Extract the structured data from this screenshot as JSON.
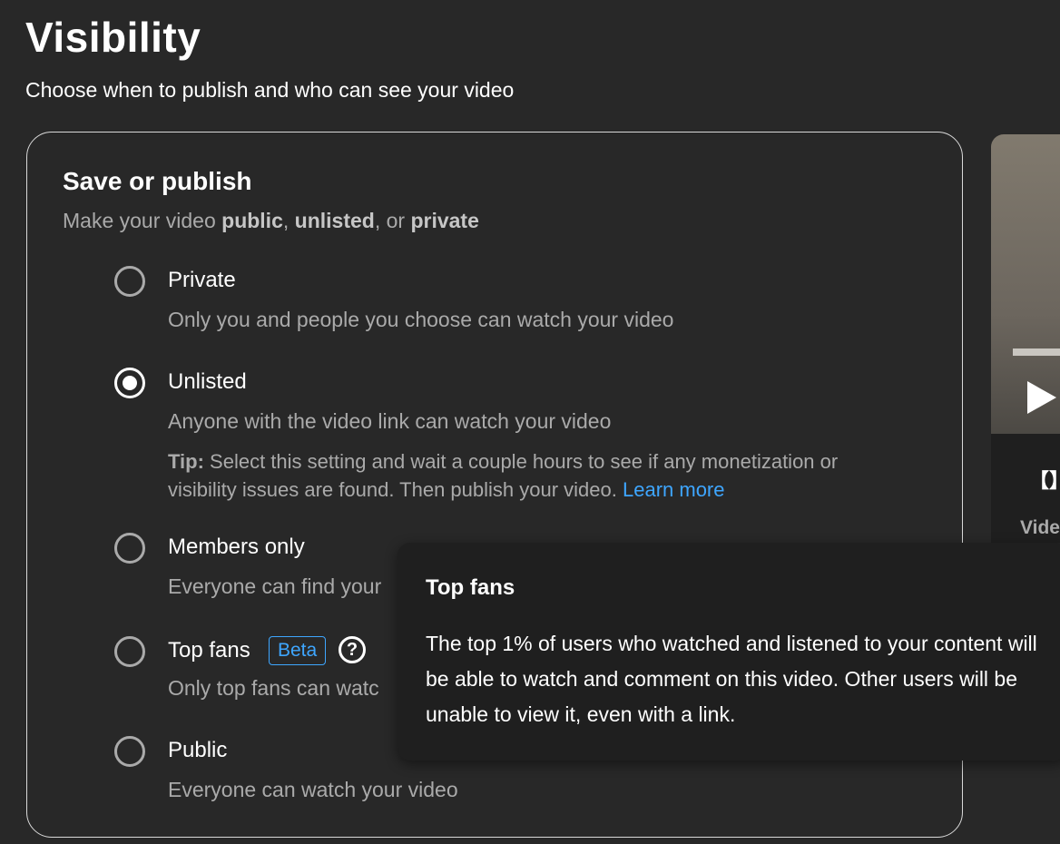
{
  "header": {
    "title": "Visibility",
    "subtitle": "Choose when to publish and who can see your video"
  },
  "card": {
    "title": "Save or publish",
    "subtitle_prefix": "Make your video ",
    "subtitle_public": "public",
    "subtitle_sep1": ", ",
    "subtitle_unlisted": "unlisted",
    "subtitle_sep2": ", or ",
    "subtitle_private": "private"
  },
  "options": {
    "private": {
      "label": "Private",
      "desc": "Only you and people you choose can watch your video",
      "selected": false
    },
    "unlisted": {
      "label": "Unlisted",
      "desc": "Anyone with the video link can watch your video",
      "selected": true,
      "tip_label": "Tip:",
      "tip_text": " Select this setting and wait a couple hours to see if any monetization or visibility issues are found. Then publish your video. ",
      "learn_more": "Learn more"
    },
    "members": {
      "label": "Members only",
      "desc": "Everyone can find your",
      "selected": false
    },
    "topfans": {
      "label": "Top fans",
      "badge": "Beta",
      "help": "?",
      "desc": "Only top fans can watc",
      "selected": false
    },
    "public": {
      "label": "Public",
      "desc": "Everyone can watch your video",
      "selected": false
    }
  },
  "preview": {
    "brackets": "【】",
    "video_label": "Vide"
  },
  "tooltip": {
    "title": "Top fans",
    "body": "The top 1% of users who watched and listened to your content will be able to watch and comment on this video. Other users will be unable to view it, even with a link."
  },
  "colors": {
    "background": "#282828",
    "link": "#3ea6ff",
    "secondary_text": "#aaaaaa",
    "tooltip_bg": "#1f1f1f"
  }
}
